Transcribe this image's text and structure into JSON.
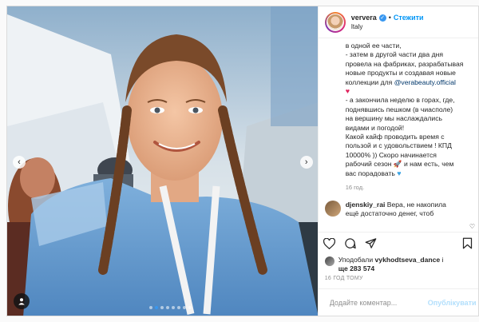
{
  "header": {
    "username": "ververa",
    "separator": "•",
    "follow_label": "Стежити",
    "location": "Italy"
  },
  "caption": {
    "lines_before_mention": [
      "в одной ее части,",
      "- затем в другой части два дня",
      "провела на фабриках, разрабатывая",
      "новые продукты и создавая новые",
      "коллекции для"
    ],
    "mention": "@verabeauty.official",
    "lines_after_heart": [
      "- а закончила неделю в горах, где,",
      "поднявшись пешком (в чиасполе)",
      "на вершину мы наслаждались",
      "видами и погодой!",
      "Какой кайф проводить время с",
      "пользой и с удовольствием ! КПД",
      "10000% )) Скоро начинается",
      "рабочий сезон",
      "и нам есть, чем",
      "вас порадовать"
    ],
    "time": "16 год."
  },
  "comment": {
    "username": "djenskiy_rai",
    "text_lines": [
      "Вера, не накопила",
      "ещё достаточно денег, чтоб"
    ]
  },
  "likes": {
    "prefix": "Уподобали",
    "user": "vykhodtseva_dance",
    "middle": "і",
    "count_text": "ще 283 574"
  },
  "time_ago": "16 ГОД ТОМУ",
  "add_comment": {
    "placeholder": "Додайте коментар...",
    "publish_label": "Опублікувати"
  },
  "carousel": {
    "slide_count": 8,
    "active_slide": 1
  },
  "colors": {
    "accent": "#0095f6",
    "verified": "#3897f0",
    "mention": "#00376b"
  },
  "icons": [
    "verified-badge-icon",
    "heart-icon",
    "comment-icon",
    "share-icon",
    "bookmark-icon",
    "emoji-icon",
    "chevron-left-icon",
    "chevron-right-icon",
    "user-tag-icon"
  ]
}
